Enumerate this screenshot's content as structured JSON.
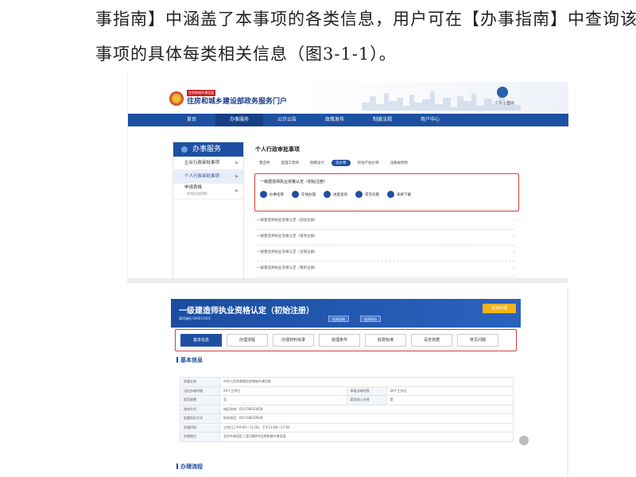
{
  "document": {
    "line1": "事指南】中涵盖了本事项的各类信息，用户可在【办事指南】中查询该",
    "line2": "事项的具体每类相关信息（图3-1-1）。"
  },
  "shot1": {
    "header_sub": "住房和城乡建设部",
    "site_title": "住房和城乡建设部政务服务门户",
    "user_label": "个人 | 登出",
    "nav": [
      "首页",
      "办事服务",
      "公示公告",
      "政策发布",
      "制度法规",
      "用户中心"
    ],
    "sidebar": {
      "title": "办事服务",
      "items": [
        {
          "label": "企业行政审批事项"
        },
        {
          "label": "个人行政审批事项"
        },
        {
          "label": "申请表格",
          "label2": "（附相关说明等）"
        }
      ]
    },
    "main": {
      "title": "个人行政审批事项",
      "tabs": [
        "建造师",
        "监理工程师",
        "勘察设计",
        "造价师",
        "房地产估价师",
        "注册规划师"
      ],
      "selected_item": "一级建造师执业资格认定（初始注册）",
      "buttons": [
        "办事指南",
        "在线办理",
        "进度查询",
        "常见问题",
        "表格下载"
      ],
      "rows": [
        "一级建造师执业资格认定（延续注册）",
        "一级建造师执业资格认定（增项注册）",
        "一级建造师执业资格认定（注销注册）",
        "一级建造师执业资格认定（重新注册）"
      ]
    }
  },
  "shot2": {
    "banner_title": "一级建造师执业资格认定（初始注册）",
    "banner_sub": "事项编码 000013001",
    "banner_btn1": "在线咨询",
    "banner_btn2": "在线评价",
    "banner_cta": "在线办理",
    "tabs": [
      "基本信息",
      "办理流程",
      "办理材料目录",
      "受理条件",
      "收费标准",
      "设定依据",
      "常见问题"
    ],
    "section_basic": "基本信息",
    "section_flow": "办理流程",
    "table": [
      [
        "实施主体",
        "中华人民共和国住房和城乡建设部",
        "",
        ""
      ],
      [
        "法定办结时限",
        "20个工作日",
        "承诺办结时限",
        "20个工作日"
      ],
      [
        "是否收费",
        "否",
        "是否网上办理",
        "是"
      ],
      [
        "咨询方式",
        "电话咨询：010-58933928",
        "",
        ""
      ],
      [
        "监督投诉方式",
        "投诉电话：010-58933928",
        "",
        ""
      ],
      [
        "办理时间",
        "工作日上午9:00—11:00，下午13:00—17:00",
        "",
        ""
      ],
      [
        "办理地点",
        "北京市海淀区三里河路9号住房和城乡建设部",
        "",
        ""
      ]
    ]
  }
}
